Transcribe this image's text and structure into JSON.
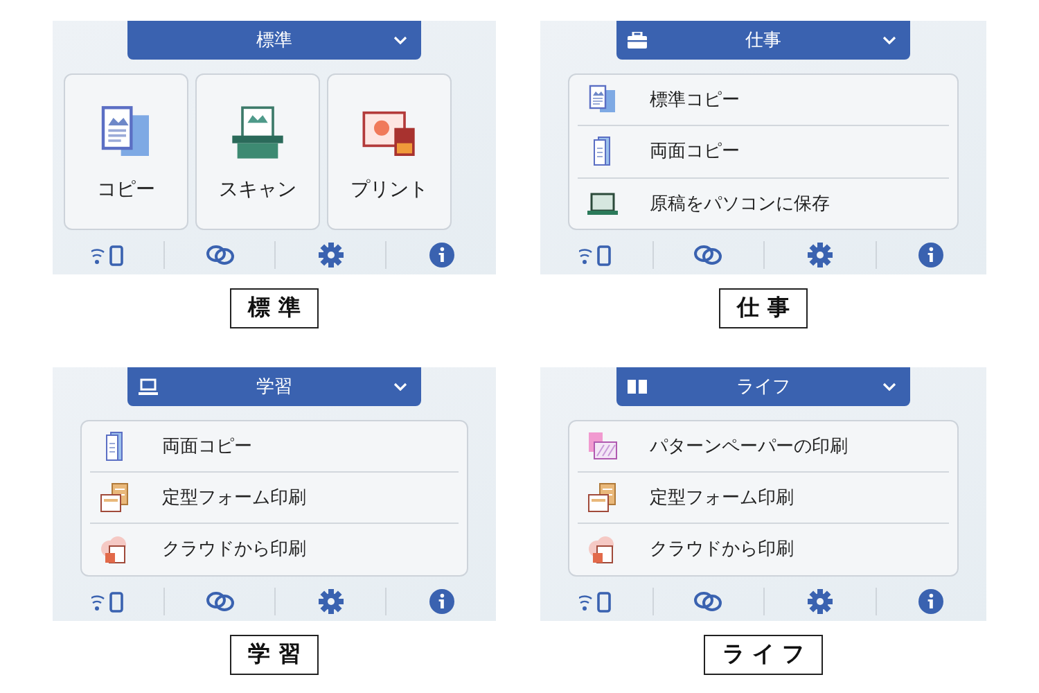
{
  "panels": [
    {
      "kind": "tiles",
      "header": {
        "title": "標準"
      },
      "items": [
        {
          "label": "コピー",
          "kind": "copy"
        },
        {
          "label": "スキャン",
          "kind": "scan"
        },
        {
          "label": "プリント",
          "kind": "print"
        }
      ],
      "caption": "標 準"
    },
    {
      "kind": "list",
      "header": {
        "kind": "briefcase",
        "title": "仕事"
      },
      "items": [
        {
          "label": "標準コピー",
          "kind": "copy"
        },
        {
          "label": "両面コピー",
          "kind": "duplex"
        },
        {
          "label": "原稿をパソコンに保存",
          "kind": "laptop"
        }
      ],
      "caption": "仕 事"
    },
    {
      "kind": "list",
      "header": {
        "kind": "laptop",
        "title": "学習"
      },
      "items": [
        {
          "label": "両面コピー",
          "kind": "duplex"
        },
        {
          "label": "定型フォーム印刷",
          "kind": "form"
        },
        {
          "label": "クラウドから印刷",
          "kind": "cloud"
        }
      ],
      "caption": "学 習"
    },
    {
      "kind": "list",
      "header": {
        "kind": "book",
        "title": "ライフ"
      },
      "items": [
        {
          "label": "パターンペーパーの印刷",
          "kind": "pattern"
        },
        {
          "label": "定型フォーム印刷",
          "kind": "form"
        },
        {
          "label": "クラウドから印刷",
          "kind": "cloud"
        }
      ],
      "caption": "ラ イ フ"
    }
  ]
}
